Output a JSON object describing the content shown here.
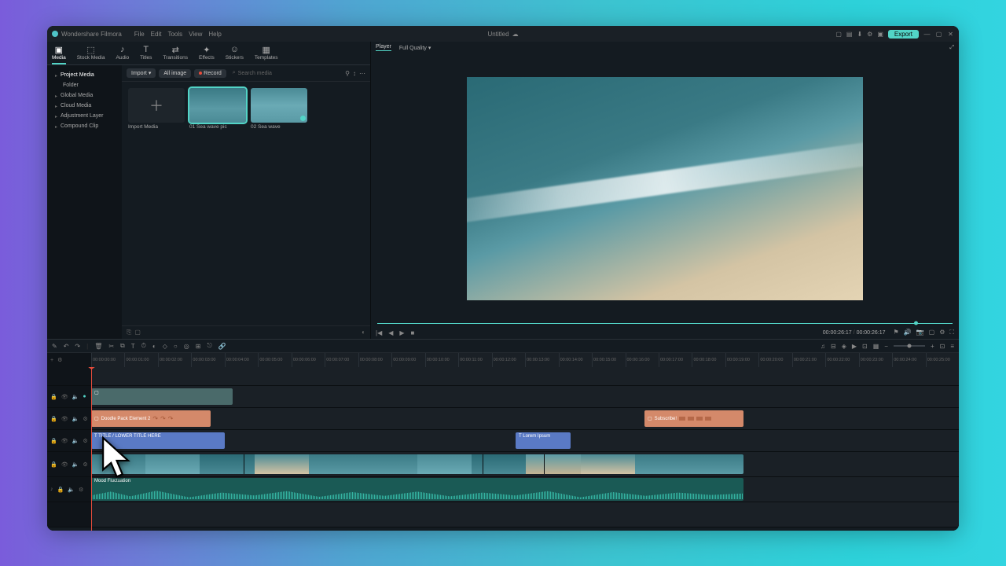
{
  "titlebar": {
    "brand": "Wondershare Filmora",
    "menu": [
      "File",
      "Edit",
      "Tools",
      "View",
      "Help"
    ],
    "doc": "Untitled",
    "export": "Export"
  },
  "tabs": [
    {
      "label": "Media"
    },
    {
      "label": "Stock Media"
    },
    {
      "label": "Audio"
    },
    {
      "label": "Titles"
    },
    {
      "label": "Transitions"
    },
    {
      "label": "Effects"
    },
    {
      "label": "Stickers"
    },
    {
      "label": "Templates"
    }
  ],
  "tree": {
    "header": "Project Media",
    "items": [
      "Folder",
      "Global Media",
      "Cloud Media",
      "Adjustment Layer",
      "Compound Clip"
    ]
  },
  "media_tb": {
    "import": "Import",
    "all": "All image",
    "record": "Record",
    "search": "Search media"
  },
  "cards": {
    "import": "Import Media",
    "c1": "01 Sea wave pic",
    "c2": "02 Sea wave"
  },
  "preview": {
    "player": "Player",
    "quality": "Full Quality",
    "cur": "00:00:26:17",
    "total": "00:00:26:17"
  },
  "ruler": [
    "00:00:00:00",
    "00:00:01:00",
    "00:00:02:00",
    "00:00:03:00",
    "00:00:04:00",
    "00:00:05:00",
    "00:00:06:00",
    "00:00:07:00",
    "00:00:08:00",
    "00:00:09:00",
    "00:00:10:00",
    "00:00:11:00",
    "00:00:12:00",
    "00:00:13:00",
    "00:00:14:00",
    "00:00:15:00",
    "00:00:16:00",
    "00:00:17:00",
    "00:00:18:00",
    "00:00:19:00",
    "00:00:20:00",
    "00:00:21:00",
    "00:00:22:00",
    "00:00:23:00",
    "00:00:24:00",
    "00:00:25:00"
  ],
  "clips": {
    "effect1": "Doodle Pack Element 2",
    "effect2": "Subscribe!",
    "title1": "TITLE / LOWER TITLE HERE",
    "title2": "Lorem Ipsum",
    "audio": "Mood Fluctuation"
  }
}
